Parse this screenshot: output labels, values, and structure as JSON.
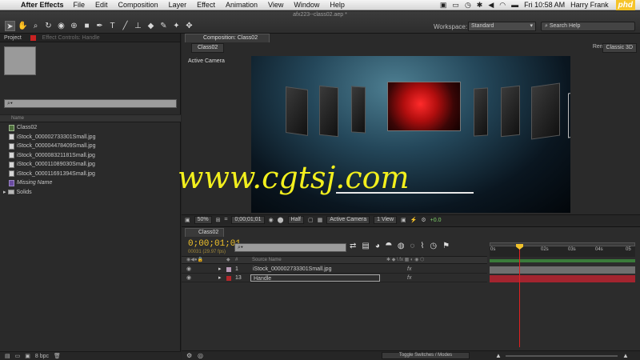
{
  "menubar": {
    "app_name": "After Effects",
    "menus": [
      "File",
      "Edit",
      "Composition",
      "Layer",
      "Effect",
      "Animation",
      "View",
      "Window",
      "Help"
    ],
    "clock": "Fri 10:58 AM",
    "user": "Harry Frank",
    "logo": "phd"
  },
  "toolbar": {
    "document_title": "afx223--class02.aep *",
    "workspace_label": "Workspace:",
    "workspace_value": "Standard",
    "search_placeholder": "Search Help"
  },
  "project": {
    "tabs": [
      "Project",
      "Effect Controls: Handle"
    ],
    "column_name": "Name",
    "items": [
      {
        "label": "Class02",
        "type": "comp"
      },
      {
        "label": "iStock_000002733301Small.jpg",
        "type": "file"
      },
      {
        "label": "iStock_000004478409Small.jpg",
        "type": "file"
      },
      {
        "label": "iStock_000008321181Small.jpg",
        "type": "file"
      },
      {
        "label": "iStock_000011089030Small.jpg",
        "type": "file"
      },
      {
        "label": "iStock_000011691394Small.jpg",
        "type": "file"
      },
      {
        "label": "Missing Name",
        "type": "missing"
      },
      {
        "label": "Solids",
        "type": "folder"
      }
    ],
    "bpc": "8 bpc"
  },
  "composition": {
    "tab": "Composition: Class02",
    "sub_tab": "Class02",
    "renderer_label": "Renderer:",
    "renderer_value": "Classic 3D",
    "camera_label": "Active Camera",
    "zoom": "50%",
    "timecode": "0;00;01;01",
    "resolution": "Half",
    "view_camera": "Active Camera",
    "views": "1 View",
    "exposure": "+0.0",
    "watermark": "www.cgtsj.com"
  },
  "timeline": {
    "tab": "Class02",
    "timecode": "0;00;01;01",
    "frames": "00031 (29.97 fps)",
    "column_source": "Source Name",
    "ruler_ticks": [
      "0s",
      "02s",
      "03s",
      "04s",
      "05"
    ],
    "layers": [
      {
        "num": "1",
        "name": "iStock_000002733301Small.jpg",
        "color": "#b79ab6"
      },
      {
        "num": "13",
        "name": "Handle",
        "color": "#b3262a"
      }
    ],
    "footer_toggle": "Toggle Switches / Modes"
  },
  "colors": {
    "timecode": "#f0c22b",
    "watermark": "#f2ef1d",
    "playhead": "#e02020",
    "track_red": "#a3242f"
  }
}
